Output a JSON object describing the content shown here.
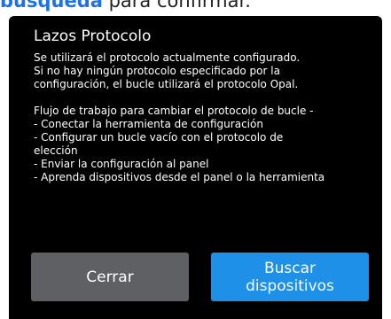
{
  "background_page": {
    "text_highlight": "búsqueda",
    "text_rest": " para confirmar."
  },
  "dialog": {
    "title": "Lazos Protocolo",
    "paragraph_1": "Se utilizará el protocolo actualmente configurado.\nSi no hay ningún protocolo especificado por la\nconfiguración, el bucle utilizará el protocolo Opal.",
    "paragraph_2": "Flujo de trabajo para cambiar el protocolo de bucle -\n  - Conectar la herramienta de configuración\n  - Configurar un bucle vacío con el protocolo de\nelección\n  - Enviar la configuración al panel\n  - Aprenda dispositivos desde el panel o la herramienta",
    "buttons": {
      "close_label": "Cerrar",
      "search_label_line1": "Buscar",
      "search_label_line2": "dispositivos"
    }
  },
  "colors": {
    "dialog_bg": "#000000",
    "close_button": "#5f6064",
    "search_button": "#1e90e8",
    "highlight": "#1a73e8"
  }
}
